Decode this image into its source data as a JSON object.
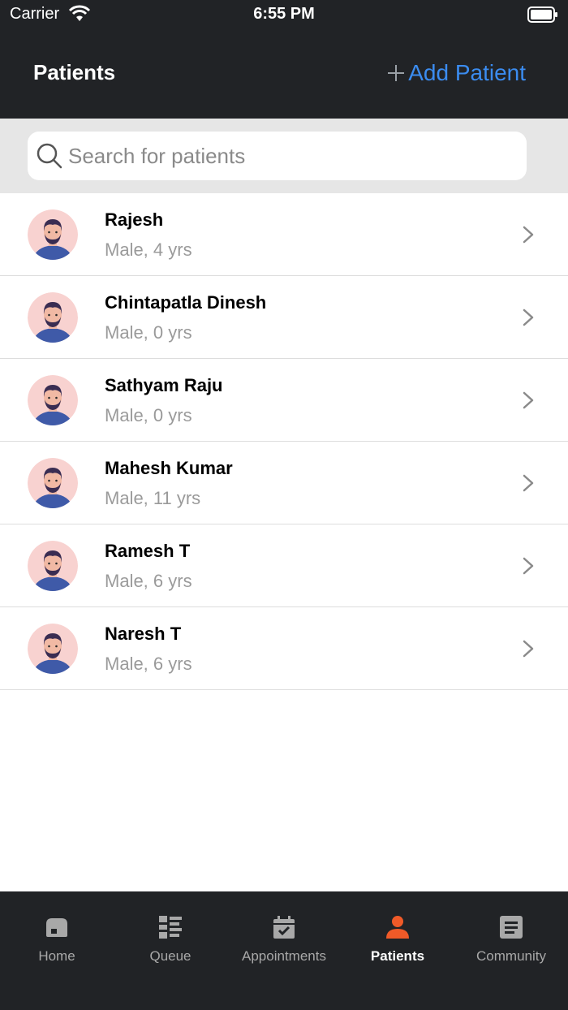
{
  "status_bar": {
    "carrier": "Carrier",
    "time": "6:55 PM"
  },
  "header": {
    "title": "Patients",
    "add_button_label": "Add Patient",
    "accent_color": "#3b8cf0"
  },
  "search": {
    "placeholder": "Search for patients",
    "value": ""
  },
  "patients": [
    {
      "name": "Rajesh",
      "details": "Male, 4 yrs"
    },
    {
      "name": "Chintapatla Dinesh",
      "details": "Male, 0 yrs"
    },
    {
      "name": "Sathyam Raju",
      "details": "Male, 0 yrs"
    },
    {
      "name": "Mahesh Kumar",
      "details": "Male, 11 yrs"
    },
    {
      "name": "Ramesh T",
      "details": "Male, 6 yrs"
    },
    {
      "name": "Naresh T",
      "details": "Male, 6 yrs"
    }
  ],
  "tabs": [
    {
      "label": "Home",
      "icon": "home-icon",
      "active": false
    },
    {
      "label": "Queue",
      "icon": "queue-icon",
      "active": false
    },
    {
      "label": "Appointments",
      "icon": "calendar-icon",
      "active": false
    },
    {
      "label": "Patients",
      "icon": "person-icon",
      "active": true
    },
    {
      "label": "Community",
      "icon": "document-icon",
      "active": false
    }
  ],
  "colors": {
    "bar_background": "#212326",
    "active_tab": "#f05a28",
    "inactive_tab": "#a8a8a8"
  }
}
